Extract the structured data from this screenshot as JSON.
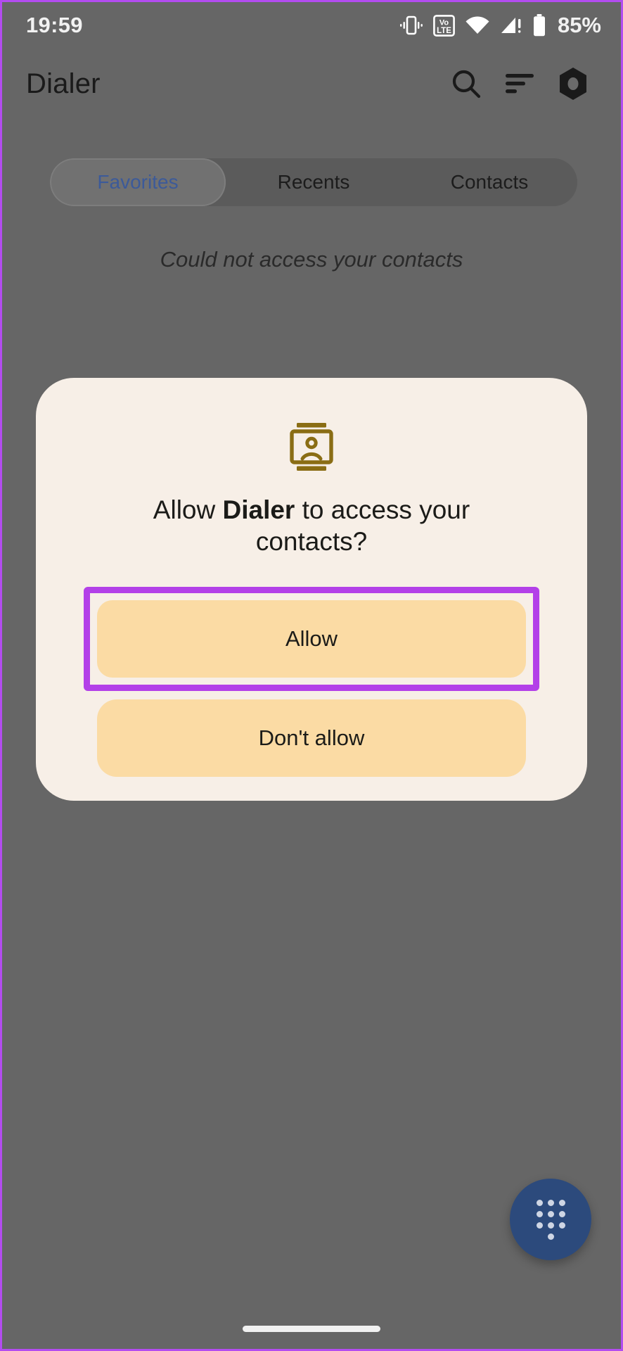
{
  "status_bar": {
    "time": "19:59",
    "battery_percent": "85%",
    "icons": [
      "vibrate-icon",
      "volte-icon",
      "wifi-icon",
      "cellular-signal-icon",
      "battery-icon"
    ],
    "volte_top": "Vo",
    "volte_bottom": "LTE"
  },
  "app_bar": {
    "title": "Dialer",
    "actions": [
      "search-icon",
      "sort-icon",
      "hexagon-avatar-icon"
    ]
  },
  "tabs": [
    {
      "label": "Favorites",
      "selected": true
    },
    {
      "label": "Recents",
      "selected": false
    },
    {
      "label": "Contacts",
      "selected": false
    }
  ],
  "content": {
    "empty_message": "Could not access your contacts"
  },
  "fab": {
    "name": "dialpad-fab",
    "icon": "dialpad-icon"
  },
  "dialog": {
    "icon": "contacts-card-icon",
    "title_prefix": "Allow ",
    "title_app": "Dialer",
    "title_suffix": " to access your contacts?",
    "buttons": [
      {
        "label": "Allow",
        "highlighted": true
      },
      {
        "label": "Don't allow",
        "highlighted": false
      }
    ]
  },
  "colors": {
    "scrim": "#666666",
    "dialog_surface": "#f7efe7",
    "button_fill": "#fbdba4",
    "dialog_icon": "#8a6d14",
    "highlight": "#b340e8",
    "tab_active_text": "#3c5a99",
    "fab": "#2c4a7c",
    "device_frame": "#b34cf0"
  }
}
